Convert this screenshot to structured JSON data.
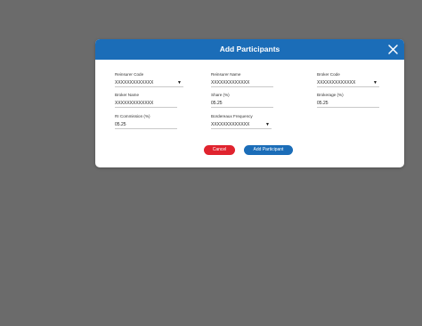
{
  "modal": {
    "title": "Add Participants",
    "close_icon": "close-icon",
    "header_color": "#1b6db8"
  },
  "fields": {
    "reinsurer_code": {
      "label": "Reinsurer Code",
      "value": "XXXXXXXXXXXXX",
      "type": "select"
    },
    "reinsurer_name": {
      "label": "Reinsurer Name",
      "value": "XXXXXXXXXXXXX"
    },
    "broker_code": {
      "label": "Broker Code",
      "value": "XXXXXXXXXXXXX",
      "type": "select"
    },
    "broker_name": {
      "label": "Broker Name",
      "value": "XXXXXXXXXXXXX"
    },
    "share": {
      "label": "Share (%)",
      "value": "05.25"
    },
    "brokerage": {
      "label": "Brokerage (%)",
      "value": "05.25"
    },
    "ri_commission": {
      "label": "RI Commission (%)",
      "value": "05.25"
    },
    "bordereaux_frequency": {
      "label": "Bordereaux Frequency",
      "value": "XXXXXXXXXXXXX",
      "type": "select"
    }
  },
  "buttons": {
    "cancel_label": "Cancel",
    "cancel_color": "#e0232e",
    "add_label": "Add Participant",
    "add_color": "#1b6db8"
  }
}
